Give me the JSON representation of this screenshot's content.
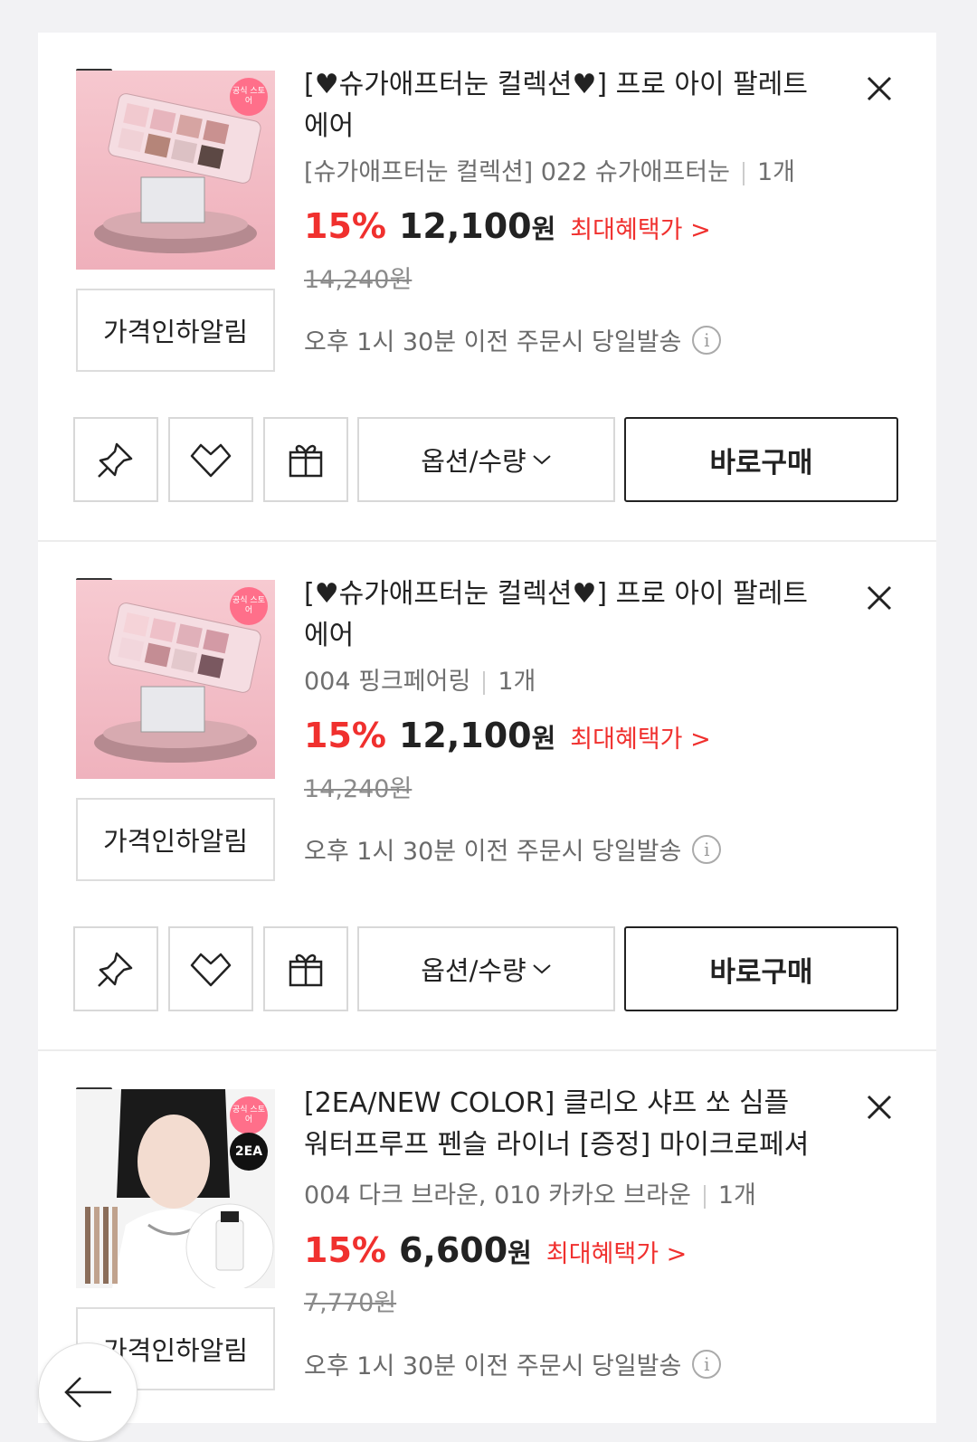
{
  "items": [
    {
      "title_line1": "[♥슈가애프터눈 컬렉션♥] 프로 아이 팔레트",
      "title_line2": "에어",
      "option": "[슈가애프터눈 컬렉션] 022 슈가애프터눈",
      "qty": "1개",
      "discount": "15%",
      "price": "12,100",
      "won": "원",
      "benefit": "최대혜택가 >",
      "original_price": "14,240원",
      "alarm_label": "가격인하알림",
      "shipping": "오후 1시 30분 이전 주문시 당일발송",
      "badge": "공식 스토어",
      "checked": true
    },
    {
      "title_line1": "[♥슈가애프터눈 컬렉션♥] 프로 아이 팔레트",
      "title_line2": "에어",
      "option": "004 핑크페어링",
      "qty": "1개",
      "discount": "15%",
      "price": "12,100",
      "won": "원",
      "benefit": "최대혜택가 >",
      "original_price": "14,240원",
      "alarm_label": "가격인하알림",
      "shipping": "오후 1시 30분 이전 주문시 당일발송",
      "badge": "공식 스토어",
      "checked": true
    },
    {
      "title_line1": "[2EA/NEW COLOR] 클리오 샤프 쏘 심플",
      "title_line2": "워터프루프 펜슬 라이너 [증정] 마이크로페셔",
      "option": "004 다크 브라운, 010 카카오 브라운",
      "qty": "1개",
      "discount": "15%",
      "price": "6,600",
      "won": "원",
      "benefit": "최대혜택가 >",
      "original_price": "7,770원",
      "alarm_label": "가격인하알림",
      "shipping": "오후 1시 30분 이전 주문시 당일발송",
      "badge": "공식 스토어",
      "badge2": "2EA",
      "checked": true
    }
  ],
  "actions": {
    "options_label": "옵션/수량",
    "buy_now_label": "바로구매"
  },
  "icons": [
    "check-icon",
    "close-icon",
    "pin-icon",
    "heart-icon",
    "gift-icon",
    "chevron-down-icon",
    "info-icon",
    "back-arrow-icon"
  ],
  "colors": {
    "discount": "#f0302e",
    "background": "#f2f2f4"
  }
}
